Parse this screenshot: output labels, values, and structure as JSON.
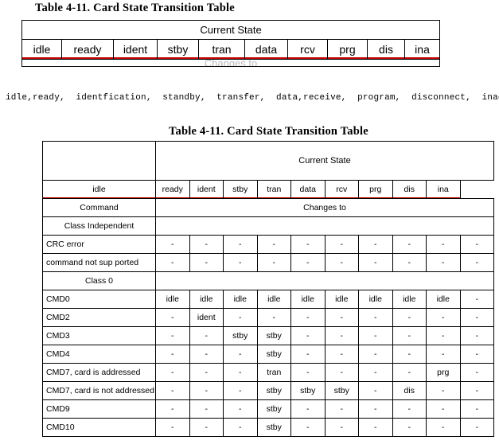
{
  "top_table": {
    "title": "Table 4-11.  Card State Transition Table",
    "header_span": "Current State",
    "states": [
      "idle",
      "ready",
      "ident",
      "stby",
      "tran",
      "data",
      "rcv",
      "prg",
      "dis",
      "ina"
    ],
    "clipped_row_text": "Changes to",
    "underline_color": "#c00000"
  },
  "legend": {
    "text": "idle,ready,  identfication,  standby,  transfer,  data,receive,  program,  disconnect,  inactive"
  },
  "bottom_table": {
    "title": "Table 4-11.  Card State Transition Table",
    "header_span": "Current State",
    "states": [
      "idle",
      "ready",
      "ident",
      "stby",
      "tran",
      "data",
      "rcv",
      "prg",
      "dis",
      "ina"
    ],
    "command_label": "Command",
    "changes_to_label": "Changes to",
    "section_class_independent": "Class Independent",
    "section_class_0": "Class 0",
    "rows": [
      {
        "label": "CRC error",
        "type": "data",
        "values": [
          "-",
          "-",
          "-",
          "-",
          "-",
          "-",
          "-",
          "-",
          "-",
          "-"
        ]
      },
      {
        "label": "command not sup ported",
        "type": "data",
        "values": [
          "-",
          "-",
          "-",
          "-",
          "-",
          "-",
          "-",
          "-",
          "-",
          "-"
        ]
      },
      {
        "label": "CMD0",
        "type": "data",
        "values": [
          "idle",
          "idle",
          "idle",
          "idle",
          "idle",
          "idle",
          "idle",
          "idle",
          "idle",
          "-"
        ]
      },
      {
        "label": "CMD2",
        "type": "data",
        "values": [
          "-",
          "ident",
          "-",
          "-",
          "-",
          "-",
          "-",
          "-",
          "-",
          "-"
        ]
      },
      {
        "label": "CMD3",
        "type": "data",
        "values": [
          "-",
          "-",
          "stby",
          "stby",
          "-",
          "-",
          "-",
          "-",
          "-",
          "-"
        ]
      },
      {
        "label": "CMD4",
        "type": "data",
        "values": [
          "-",
          "-",
          "-",
          "stby",
          "-",
          "-",
          "-",
          "-",
          "-",
          "-"
        ]
      },
      {
        "label": "CMD7, card is addressed",
        "type": "data",
        "values": [
          "-",
          "-",
          "-",
          "tran",
          "-",
          "-",
          "-",
          "-",
          "prg",
          "-"
        ]
      },
      {
        "label": "CMD7, card is not addressed",
        "type": "data",
        "values": [
          "-",
          "-",
          "-",
          "stby",
          "stby",
          "stby",
          "-",
          "dis",
          "-",
          "-"
        ]
      },
      {
        "label": "CMD9",
        "type": "data",
        "values": [
          "-",
          "-",
          "-",
          "stby",
          "-",
          "-",
          "-",
          "-",
          "-",
          "-"
        ]
      },
      {
        "label": "CMD10",
        "type": "data",
        "values": [
          "-",
          "-",
          "-",
          "stby",
          "-",
          "-",
          "-",
          "-",
          "-",
          "-"
        ]
      }
    ]
  }
}
